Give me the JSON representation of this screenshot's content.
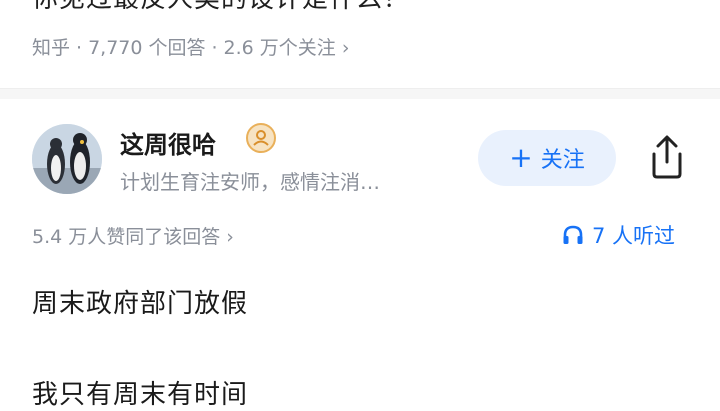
{
  "question": {
    "title": "你见过最反人类的设计是什么？",
    "site": "知乎",
    "answers": "7,770 个回答",
    "followers": "2.6 万个关注",
    "chevron": "›"
  },
  "author": {
    "name": "这周很哈",
    "badge_icon": "person-badge-icon",
    "description": "计划生育注安师，感情注消…",
    "follow_label": "关注",
    "follow_prefix": "+"
  },
  "answer": {
    "likes": "5.4 万人赞同了该回答 ›",
    "listened": "7 人听过",
    "paragraphs": [
      "周末政府部门放假",
      "我只有周末有时间"
    ]
  },
  "colors": {
    "accent": "#1772f6",
    "muted": "#8a8f99",
    "follow_bg": "#e9f1fd"
  }
}
